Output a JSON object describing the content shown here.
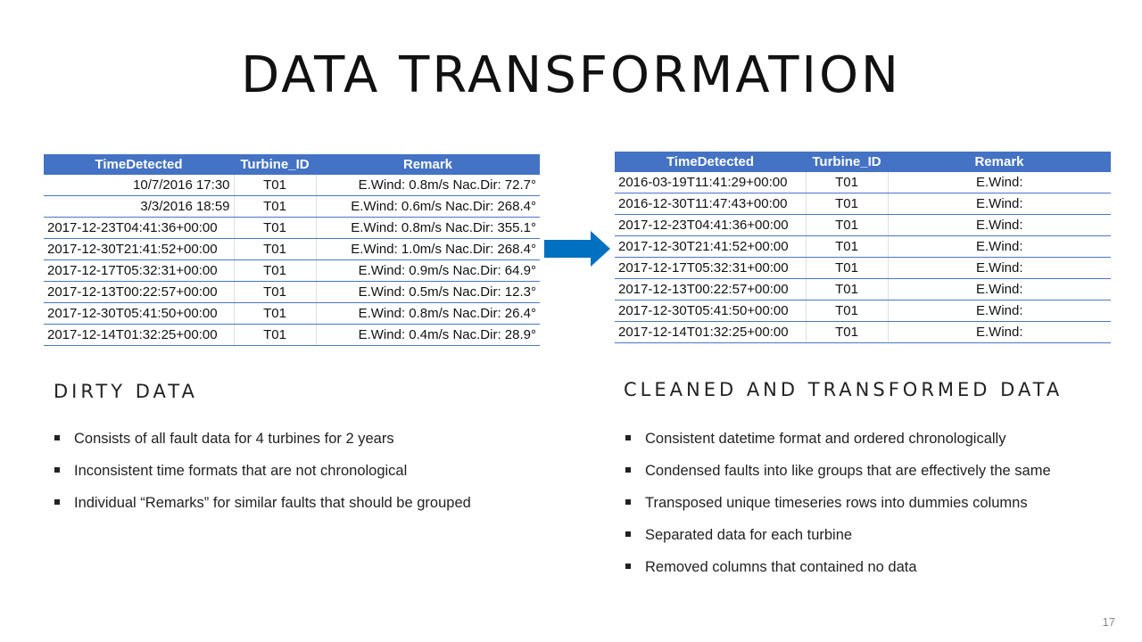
{
  "slide": {
    "title": "DATA TRANSFORMATION",
    "page_number": "17"
  },
  "colors": {
    "table_header": "#4472c4",
    "arrow": "#0070c0"
  },
  "dirty_table": {
    "headers": [
      "TimeDetected",
      "Turbine_ID",
      "Remark"
    ],
    "rows": [
      [
        "10/7/2016 17:30",
        "T01",
        "E.Wind: 0.8m/s Nac.Dir:  72.7°"
      ],
      [
        "3/3/2016 18:59",
        "T01",
        "E.Wind: 0.6m/s Nac.Dir: 268.4°"
      ],
      [
        "2017-12-23T04:41:36+00:00",
        "T01",
        "E.Wind: 0.8m/s Nac.Dir: 355.1°"
      ],
      [
        "2017-12-30T21:41:52+00:00",
        "T01",
        "E.Wind: 1.0m/s Nac.Dir: 268.4°"
      ],
      [
        "2017-12-17T05:32:31+00:00",
        "T01",
        "E.Wind: 0.9m/s Nac.Dir:  64.9°"
      ],
      [
        "2017-12-13T00:22:57+00:00",
        "T01",
        "E.Wind: 0.5m/s Nac.Dir:  12.3°"
      ],
      [
        "2017-12-30T05:41:50+00:00",
        "T01",
        "E.Wind: 0.8m/s Nac.Dir:  26.4°"
      ],
      [
        "2017-12-14T01:32:25+00:00",
        "T01",
        "E.Wind: 0.4m/s Nac.Dir:  28.9°"
      ]
    ]
  },
  "clean_table": {
    "headers": [
      "TimeDetected",
      "Turbine_ID",
      "Remark"
    ],
    "rows": [
      [
        "2016-03-19T11:41:29+00:00",
        "T01",
        "E.Wind:"
      ],
      [
        "2016-12-30T11:47:43+00:00",
        "T01",
        "E.Wind:"
      ],
      [
        "2017-12-23T04:41:36+00:00",
        "T01",
        "E.Wind:"
      ],
      [
        "2017-12-30T21:41:52+00:00",
        "T01",
        "E.Wind:"
      ],
      [
        "2017-12-17T05:32:31+00:00",
        "T01",
        "E.Wind:"
      ],
      [
        "2017-12-13T00:22:57+00:00",
        "T01",
        "E.Wind:"
      ],
      [
        "2017-12-30T05:41:50+00:00",
        "T01",
        "E.Wind:"
      ],
      [
        "2017-12-14T01:32:25+00:00",
        "T01",
        "E.Wind:"
      ]
    ]
  },
  "dirty_section": {
    "heading": "DIRTY DATA",
    "bullets": [
      "Consists of all fault data for 4 turbines for 2 years",
      "Inconsistent time formats that are not chronological",
      "Individual “Remarks” for similar faults that should be grouped"
    ]
  },
  "clean_section": {
    "heading": "CLEANED AND TRANSFORMED DATA",
    "bullets": [
      "Consistent datetime format and ordered chronologically",
      "Condensed faults into like groups that are effectively the same",
      "Transposed unique timeseries rows into dummies columns",
      "Separated data for each turbine",
      "Removed columns that contained no data"
    ]
  }
}
